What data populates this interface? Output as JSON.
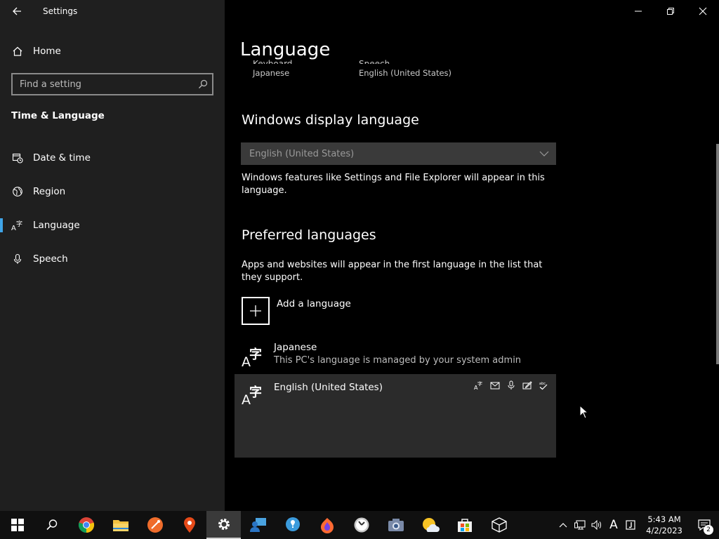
{
  "window": {
    "app_title": "Settings"
  },
  "sidebar": {
    "home_label": "Home",
    "search_placeholder": "Find a setting",
    "section_title": "Time & Language",
    "items": [
      {
        "label": "Date & time",
        "icon": "clock-calendar-icon"
      },
      {
        "label": "Region",
        "icon": "globe-icon"
      },
      {
        "label": "Language",
        "icon": "language-icon",
        "selected": true
      },
      {
        "label": "Speech",
        "icon": "microphone-icon"
      }
    ]
  },
  "main": {
    "page_title": "Language",
    "pinned": [
      {
        "label": "Keyboard",
        "value": "Japanese"
      },
      {
        "label": "Speech",
        "value": "English (United States)"
      }
    ],
    "display_language": {
      "heading": "Windows display language",
      "selected": "English (United States)",
      "description": "Windows features like Settings and File Explorer will appear in this language."
    },
    "preferred": {
      "heading": "Preferred languages",
      "description": "Apps and websites will appear in the first language in the list that they support.",
      "add_label": "Add a language",
      "languages": [
        {
          "name": "Japanese",
          "subtitle": "This PC's language is managed by your system admin"
        },
        {
          "name": "English (United States)",
          "subtitle": ""
        }
      ]
    }
  },
  "taskbar": {
    "apps": [
      "windows-start-icon",
      "search-icon",
      "chrome-icon",
      "file-explorer-icon",
      "postman-icon",
      "maps-pin-icon",
      "settings-gear-icon",
      "people-icon",
      "bulb-icon",
      "firefox-icon",
      "clock-app-icon",
      "camera-icon",
      "weather-icon",
      "store-icon",
      "3d-viewer-icon"
    ],
    "time": "5:43 AM",
    "date": "4/2/2023",
    "ime_mode": "A",
    "notification_count": "2"
  },
  "colors": {
    "sidebar_bg": "#1f1f1f",
    "main_bg": "#000000",
    "accent": "#3fa4e7",
    "taskbar_bg": "#101010"
  }
}
